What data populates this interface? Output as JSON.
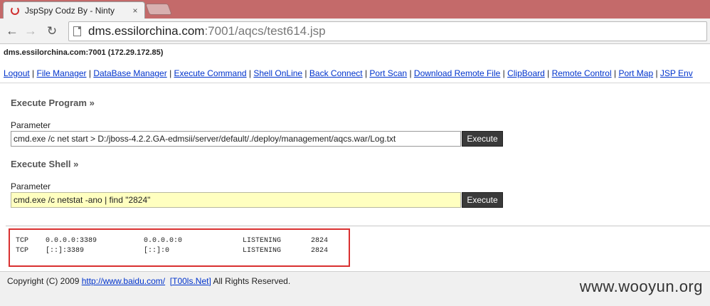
{
  "browser": {
    "tab_title": "JspSpy Codz By - Ninty",
    "tab_close": "×",
    "url_host": "dms.essilorchina.com",
    "url_path": ":7001/aqcs/test614.jsp",
    "back_icon": "back-arrow-icon",
    "forward_icon": "forward-arrow-icon",
    "reload_icon": "reload-icon"
  },
  "header": {
    "host": "dms.essilorchina.com:7001 (172.29.172.85)"
  },
  "nav": {
    "sep": " | ",
    "items": [
      "Logout",
      "File Manager",
      "DataBase Manager",
      "Execute Command",
      "Shell OnLine",
      "Back Connect",
      "Port Scan",
      "Download Remote File",
      "ClipBoard",
      "Remote Control",
      "Port Map",
      "JSP Env"
    ]
  },
  "execute_program": {
    "title": "Execute Program",
    "raquo": "»",
    "param_label": "Parameter",
    "value": "cmd.exe /c net start > D:/jboss-4.2.2.GA-edmsii/server/default/./deploy/management/aqcs.war/Log.txt",
    "button": "Execute"
  },
  "execute_shell": {
    "title": "Execute Shell",
    "raquo": "»",
    "param_label": "Parameter",
    "value": "cmd.exe /c netstat -ano | find \"2824\"",
    "button": "Execute"
  },
  "output": {
    "rows": [
      [
        "TCP",
        "0.0.0.0:3389",
        "0.0.0.0:0",
        "LISTENING",
        "2824"
      ],
      [
        "TCP",
        "[::]:3389",
        "[::]:0",
        "LISTENING",
        "2824"
      ]
    ]
  },
  "footer": {
    "prefix": "Copyright (C) 2009 ",
    "link1": "http://www.baidu.com/",
    "link2": "[T00ls.Net]",
    "suffix": " All Rights Reserved.",
    "watermark": "www.wooyun.org"
  },
  "colors": {
    "tabbar": "#c46a6a",
    "link": "#0033cc",
    "highlight_border": "#d93030",
    "shell_input_bg": "#ffffc0",
    "button_bg": "#3a3a3a"
  }
}
